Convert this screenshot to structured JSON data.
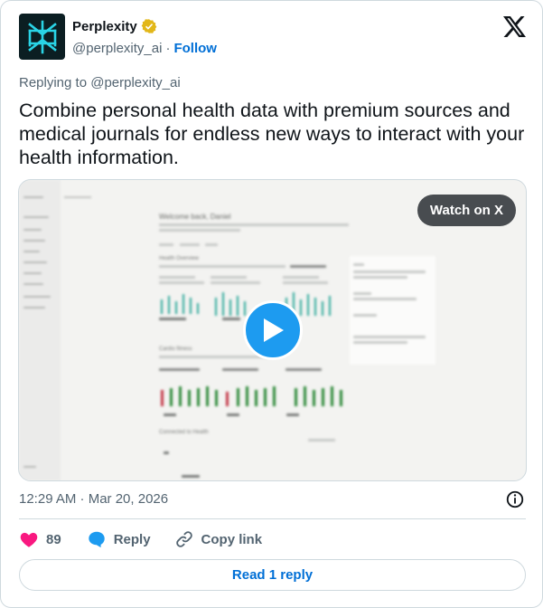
{
  "author": {
    "display_name": "Perplexity",
    "handle": "@perplexity_ai",
    "separator": "·",
    "follow_label": "Follow"
  },
  "replying_to": "Replying to @perplexity_ai",
  "tweet_text": "Combine personal health data with premium sources and medical journals for endless new ways to interact with your health information.",
  "media": {
    "watch_label": "Watch on X",
    "video_screen": {
      "welcome": "Welcome back, Daniel",
      "section_1": "Health Overview",
      "section_2": "Cardio fitness",
      "section_3": "Connected to Health"
    }
  },
  "timestamp": "12:29 AM · Mar 20, 2026",
  "actions": {
    "like_count": "89",
    "reply_label": "Reply",
    "copy_link_label": "Copy link"
  },
  "read_replies_label": "Read 1 reply",
  "colors": {
    "accent_blue": "#1d9bf0",
    "link_blue": "#006fd6",
    "like_pink": "#f91880",
    "verified_gold": "#e2b719",
    "muted_text": "#536471"
  }
}
